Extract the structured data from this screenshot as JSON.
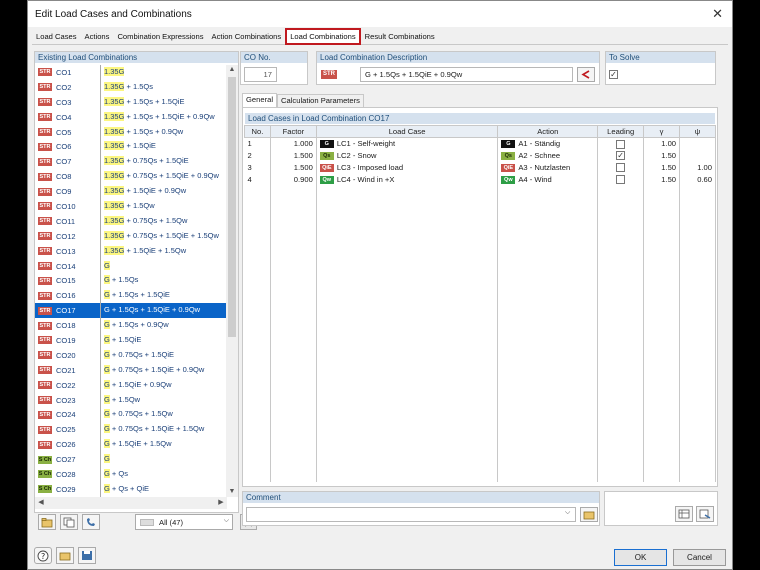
{
  "window": {
    "title": "Edit Load Cases and Combinations"
  },
  "tabs": [
    "Load Cases",
    "Actions",
    "Combination Expressions",
    "Action Combinations",
    "Load Combinations",
    "Result Combinations"
  ],
  "active_tab": "Load Combinations",
  "existing": {
    "header": "Existing Load Combinations",
    "rows": [
      {
        "badge": "STR",
        "co": "CO1",
        "pre": "1.35G",
        "post": ""
      },
      {
        "badge": "STR",
        "co": "CO2",
        "pre": "1.35G",
        "post": " + 1.5Qs"
      },
      {
        "badge": "STR",
        "co": "CO3",
        "pre": "1.35G",
        "post": " + 1.5Qs + 1.5QiE"
      },
      {
        "badge": "STR",
        "co": "CO4",
        "pre": "1.35G",
        "post": " + 1.5Qs + 1.5QiE + 0.9Qw"
      },
      {
        "badge": "STR",
        "co": "CO5",
        "pre": "1.35G",
        "post": " + 1.5Qs + 0.9Qw"
      },
      {
        "badge": "STR",
        "co": "CO6",
        "pre": "1.35G",
        "post": " + 1.5QiE"
      },
      {
        "badge": "STR",
        "co": "CO7",
        "pre": "1.35G",
        "post": " + 0.75Qs + 1.5QiE"
      },
      {
        "badge": "STR",
        "co": "CO8",
        "pre": "1.35G",
        "post": " + 0.75Qs + 1.5QiE + 0.9Qw"
      },
      {
        "badge": "STR",
        "co": "CO9",
        "pre": "1.35G",
        "post": " + 1.5QiE + 0.9Qw"
      },
      {
        "badge": "STR",
        "co": "CO10",
        "pre": "1.35G",
        "post": " + 1.5Qw"
      },
      {
        "badge": "STR",
        "co": "CO11",
        "pre": "1.35G",
        "post": " + 0.75Qs + 1.5Qw"
      },
      {
        "badge": "STR",
        "co": "CO12",
        "pre": "1.35G",
        "post": " + 0.75Qs + 1.5QiE + 1.5Qw"
      },
      {
        "badge": "STR",
        "co": "CO13",
        "pre": "1.35G",
        "post": " + 1.5QiE + 1.5Qw"
      },
      {
        "badge": "STR",
        "co": "CO14",
        "pre": "G",
        "post": ""
      },
      {
        "badge": "STR",
        "co": "CO15",
        "pre": "G",
        "post": " + 1.5Qs"
      },
      {
        "badge": "STR",
        "co": "CO16",
        "pre": "G",
        "post": " + 1.5Qs + 1.5QiE"
      },
      {
        "badge": "STR",
        "co": "CO17",
        "pre": "G",
        "post": " + 1.5Qs + 1.5QiE + 0.9Qw",
        "selected": true
      },
      {
        "badge": "STR",
        "co": "CO18",
        "pre": "G",
        "post": " + 1.5Qs + 0.9Qw"
      },
      {
        "badge": "STR",
        "co": "CO19",
        "pre": "G",
        "post": " + 1.5QiE"
      },
      {
        "badge": "STR",
        "co": "CO20",
        "pre": "G",
        "post": " + 0.75Qs + 1.5QiE"
      },
      {
        "badge": "STR",
        "co": "CO21",
        "pre": "G",
        "post": " + 0.75Qs + 1.5QiE + 0.9Qw"
      },
      {
        "badge": "STR",
        "co": "CO22",
        "pre": "G",
        "post": " + 1.5QiE + 0.9Qw"
      },
      {
        "badge": "STR",
        "co": "CO23",
        "pre": "G",
        "post": " + 1.5Qw"
      },
      {
        "badge": "STR",
        "co": "CO24",
        "pre": "G",
        "post": " + 0.75Qs + 1.5Qw"
      },
      {
        "badge": "STR",
        "co": "CO25",
        "pre": "G",
        "post": " + 0.75Qs + 1.5QiE + 1.5Qw"
      },
      {
        "badge": "STR",
        "co": "CO26",
        "pre": "G",
        "post": " + 1.5QiE + 1.5Qw"
      },
      {
        "badge": "S Ch",
        "co": "CO27",
        "pre": "G",
        "post": ""
      },
      {
        "badge": "S Ch",
        "co": "CO28",
        "pre": "G",
        "post": " + Qs"
      },
      {
        "badge": "S Ch",
        "co": "CO29",
        "pre": "G",
        "post": " + Qs + QiE"
      }
    ],
    "filter_label": "All (47)"
  },
  "co_no": {
    "label": "CO No.",
    "value": "17"
  },
  "description": {
    "label": "Load Combination Description",
    "badge": "STR",
    "value": "G + 1.5Qs + 1.5QiE + 0.9Qw"
  },
  "to_solve": {
    "label": "To Solve",
    "checked": true
  },
  "subtabs": [
    "General",
    "Calculation Parameters"
  ],
  "active_subtab": "General",
  "lc_table": {
    "header": "Load Cases in Load Combination CO17",
    "columns": [
      "No.",
      "Factor",
      "Load Case",
      "Action",
      "Leading",
      "γ",
      "ψ"
    ],
    "rows": [
      {
        "no": "1",
        "factor": "1.000",
        "lc_badge": "G",
        "lc": "LC1 - Self-weight",
        "act_badge": "G",
        "act": "A1 - Ständig",
        "leading": false,
        "gamma": "1.00",
        "psi": ""
      },
      {
        "no": "2",
        "factor": "1.500",
        "lc_badge": "Qs",
        "lc": "LC2 - Snow",
        "act_badge": "Qs",
        "act": "A2 - Schnee",
        "leading": true,
        "gamma": "1.50",
        "psi": ""
      },
      {
        "no": "3",
        "factor": "1.500",
        "lc_badge": "QiE",
        "lc": "LC3 - Imposed load",
        "act_badge": "QiE",
        "act": "A3 - Nutzlasten",
        "leading": false,
        "gamma": "1.50",
        "psi": "1.00"
      },
      {
        "no": "4",
        "factor": "0.900",
        "lc_badge": "Qw",
        "lc": "LC4 - Wind in +X",
        "act_badge": "Qw",
        "act": "A4 - Wind",
        "leading": false,
        "gamma": "1.50",
        "psi": "0.60"
      }
    ]
  },
  "comment": {
    "label": "Comment",
    "value": ""
  },
  "buttons": {
    "ok": "OK",
    "cancel": "Cancel"
  },
  "colors": {
    "str": "#c9524a",
    "sch": "#8ab043",
    "g": "#111111",
    "qs": "#8ab043",
    "qie": "#c9524a",
    "qw": "#2e9e46",
    "selection": "#0a64c8",
    "highlight": "#fcf680"
  }
}
